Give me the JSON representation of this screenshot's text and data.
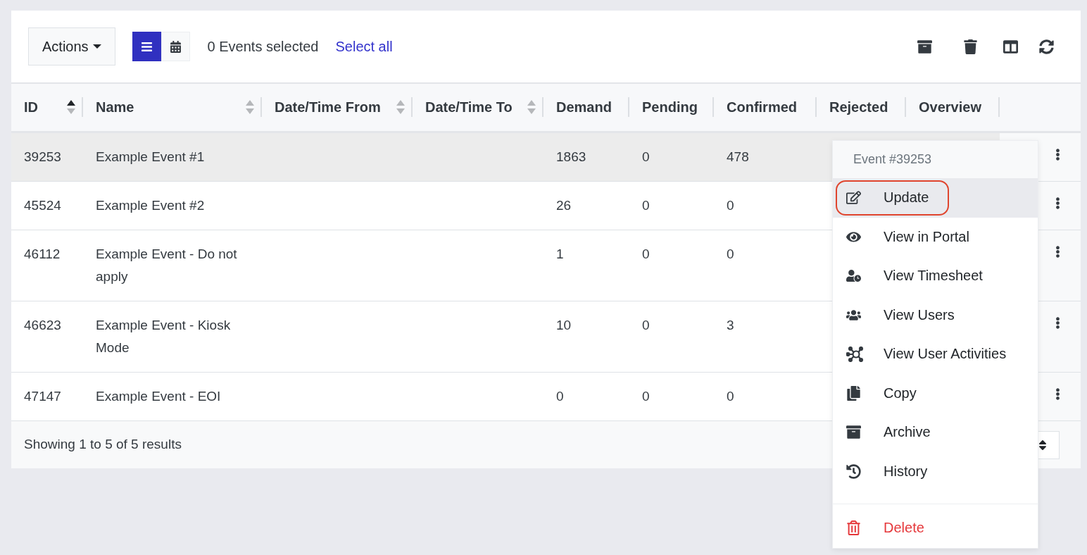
{
  "toolbar": {
    "actions_label": "Actions",
    "view_toggle": [
      {
        "selected": true
      },
      {
        "selected": false
      }
    ],
    "selection_text": "0 Events selected",
    "select_all": "Select all"
  },
  "table": {
    "columns": [
      {
        "label": "ID",
        "sortable": true,
        "sorted": true
      },
      {
        "label": "Name",
        "sortable": true,
        "sorted": false
      },
      {
        "label": "Date/Time From",
        "sortable": true,
        "sorted": false
      },
      {
        "label": "Date/Time To",
        "sortable": true,
        "sorted": false
      },
      {
        "label": "Demand",
        "sortable": false
      },
      {
        "label": "Pending",
        "sortable": false
      },
      {
        "label": "Confirmed",
        "sortable": false
      },
      {
        "label": "Rejected",
        "sortable": false
      },
      {
        "label": "Overview",
        "sortable": false
      }
    ],
    "rows": [
      {
        "id": "39253",
        "name": "Example Event #1",
        "demand": "1863",
        "pending": "0",
        "confirmed": "478",
        "selected": true
      },
      {
        "id": "45524",
        "name": "Example Event #2",
        "demand": "26",
        "pending": "0",
        "confirmed": "0",
        "selected": false
      },
      {
        "id": "46112",
        "name": "Example Event - Do not apply",
        "demand": "1",
        "pending": "0",
        "confirmed": "0",
        "selected": false
      },
      {
        "id": "46623",
        "name": "Example Event - Kiosk Mode",
        "demand": "10",
        "pending": "0",
        "confirmed": "3",
        "selected": false
      },
      {
        "id": "47147",
        "name": "Example Event - EOI",
        "demand": "0",
        "pending": "0",
        "confirmed": "0",
        "selected": false
      }
    ]
  },
  "footer": {
    "summary": "Showing 1 to 5 of 5 results"
  },
  "context_menu": {
    "title": "Event #39253",
    "items": [
      {
        "label": "Update",
        "kind": "normal",
        "selected": true
      },
      {
        "label": "View in Portal",
        "kind": "normal",
        "selected": false
      },
      {
        "label": "View Timesheet",
        "kind": "normal",
        "selected": false
      },
      {
        "label": "View Users",
        "kind": "normal",
        "selected": false
      },
      {
        "label": "View User Activities",
        "kind": "normal",
        "selected": false
      },
      {
        "label": "Copy",
        "kind": "normal",
        "selected": false
      },
      {
        "label": "Archive",
        "kind": "normal",
        "selected": false
      },
      {
        "label": "History",
        "kind": "normal",
        "selected": false
      },
      {
        "label": "Delete",
        "kind": "danger",
        "selected": false
      }
    ]
  }
}
